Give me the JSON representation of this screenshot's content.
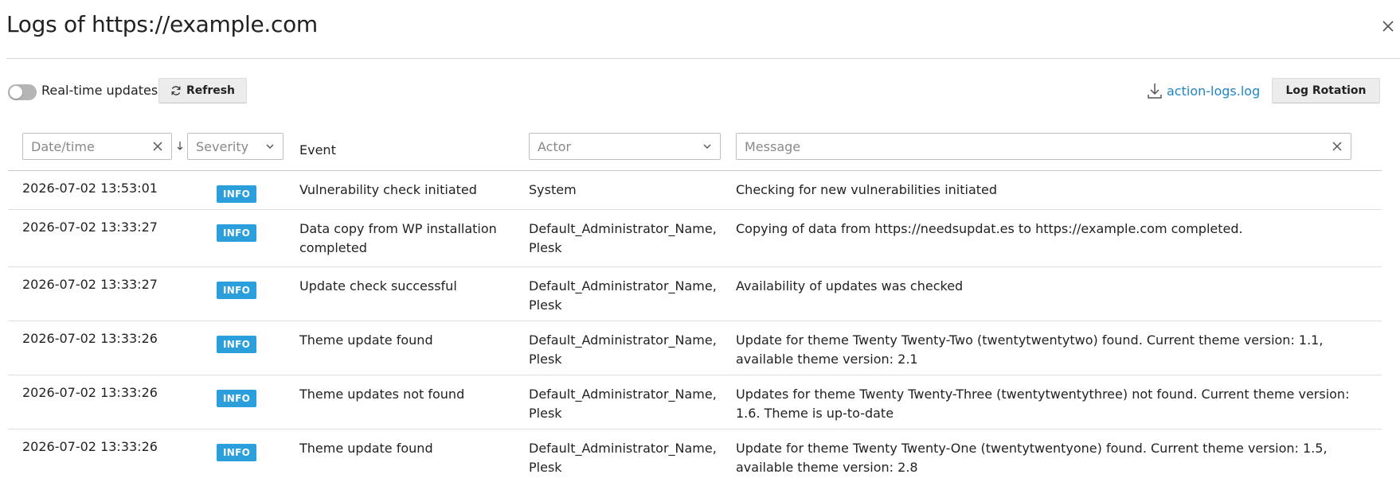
{
  "dialog": {
    "title": "Logs of https://example.com"
  },
  "toolbar": {
    "realtime_label": "Real-time updates",
    "realtime_enabled": false,
    "refresh_label": "Refresh",
    "download_label": "action-logs.log",
    "rotation_label": "Log Rotation"
  },
  "filters": {
    "datetime_placeholder": "Date/time",
    "severity_placeholder": "Severity",
    "event_header": "Event",
    "actor_placeholder": "Actor",
    "message_placeholder": "Message"
  },
  "icons": {
    "close": "close-icon",
    "refresh": "refresh-icon",
    "download": "download-icon",
    "clear": "clear-icon",
    "chevron": "chevron-down-icon",
    "sort": "sort-arrow-down-icon"
  },
  "colors": {
    "link": "#1f86c8",
    "badge_info": "#2a9fdb",
    "toggle_off": "#b5b5b5"
  },
  "rows": [
    {
      "datetime": "2026-07-02 13:53:01",
      "severity": "INFO",
      "event": "Vulnerability check initiated",
      "actor": "System",
      "message": "Checking for new vulnerabilities initiated"
    },
    {
      "datetime": "2026-07-02 13:33:27",
      "severity": "INFO",
      "event": "Data copy from WP installation completed",
      "actor": "Default_Administrator_Name, Plesk",
      "message": "Copying of data from https://needsupdat.es to https://example.com completed."
    },
    {
      "datetime": "2026-07-02 13:33:27",
      "severity": "INFO",
      "event": "Update check successful",
      "actor": "Default_Administrator_Name, Plesk",
      "message": "Availability of updates was checked"
    },
    {
      "datetime": "2026-07-02 13:33:26",
      "severity": "INFO",
      "event": "Theme update found",
      "actor": "Default_Administrator_Name, Plesk",
      "message": "Update for theme Twenty Twenty-Two (twentytwentytwo) found. Current theme version: 1.1, available theme version: 2.1"
    },
    {
      "datetime": "2026-07-02 13:33:26",
      "severity": "INFO",
      "event": "Theme updates not found",
      "actor": "Default_Administrator_Name, Plesk",
      "message": "Updates for theme Twenty Twenty-Three (twentytwentythree) not found. Current theme version: 1.6. Theme is up-to-date"
    },
    {
      "datetime": "2026-07-02 13:33:26",
      "severity": "INFO",
      "event": "Theme update found",
      "actor": "Default_Administrator_Name, Plesk",
      "message": "Update for theme Twenty Twenty-One (twentytwentyone) found. Current theme version: 1.5, available theme version: 2.8"
    }
  ]
}
